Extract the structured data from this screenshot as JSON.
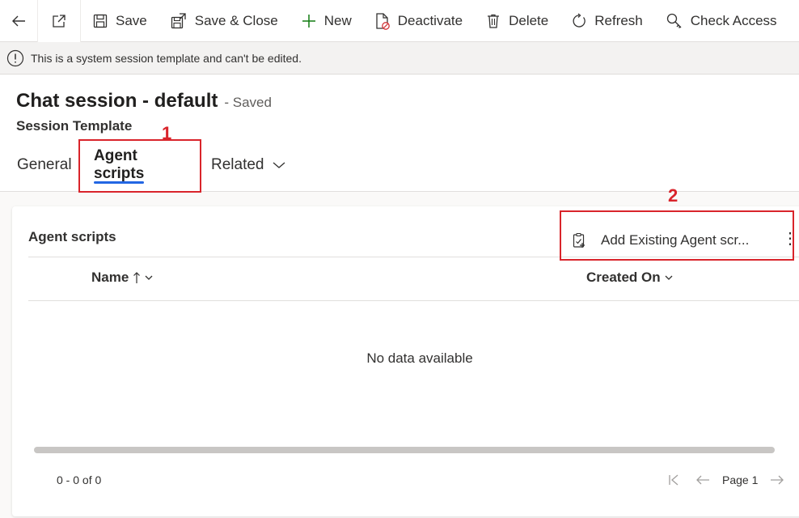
{
  "commands": {
    "save": "Save",
    "save_close": "Save & Close",
    "new": "New",
    "deactivate": "Deactivate",
    "delete": "Delete",
    "refresh": "Refresh",
    "check_access": "Check Access"
  },
  "info": {
    "message": "This is a system session template and can't be edited."
  },
  "header": {
    "title": "Chat session - default",
    "status": "- Saved",
    "entity": "Session Template"
  },
  "tabs": [
    {
      "label": "General"
    },
    {
      "label": "Agent scripts",
      "selected": true
    },
    {
      "label": "Related"
    }
  ],
  "annotations": {
    "one": "1",
    "two": "2",
    "color": "#d9242b"
  },
  "subgrid": {
    "title": "Agent scripts",
    "add_button": "Add Existing Agent scr...",
    "more": "⋮",
    "columns": [
      {
        "label": "Name",
        "sort": "ascending"
      },
      {
        "label": "Created On"
      }
    ],
    "empty_text": "No data available",
    "record_count": "0 - 0 of 0",
    "page_label": "Page 1"
  },
  "colors": {
    "accent": "#2266e3",
    "new_icon": "#107c10",
    "deactivate_badge": "#d13438"
  }
}
